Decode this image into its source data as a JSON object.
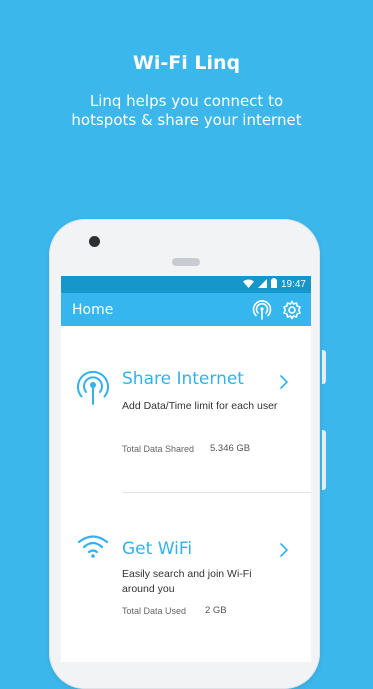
{
  "promo": {
    "title": "Wi-Fi Linq",
    "subtitle": "Linq helps you connect to hotspots & share your internet"
  },
  "status_bar": {
    "time": "19:47",
    "icons": [
      "wifi-icon",
      "signal-icon",
      "battery-icon"
    ]
  },
  "app_bar": {
    "title": "Home",
    "icons": [
      "hotspot-icon",
      "settings-icon"
    ]
  },
  "cards": [
    {
      "title": "Share Internet",
      "description": "Add Data/Time limit for each user",
      "stat_label": "Total Data Shared",
      "stat_value": "5.346 GB",
      "icon": "hotspot-icon"
    },
    {
      "title": "Get WiFi",
      "description": "Easily search and join Wi-Fi around you",
      "stat_label": "Total Data Used",
      "stat_value": "2 GB",
      "icon": "wifi-icon"
    }
  ],
  "colors": {
    "background": "#3bb7ec",
    "status_bar": "#1597c9",
    "app_bar": "#36b6ee",
    "accent": "#33b1ec"
  }
}
